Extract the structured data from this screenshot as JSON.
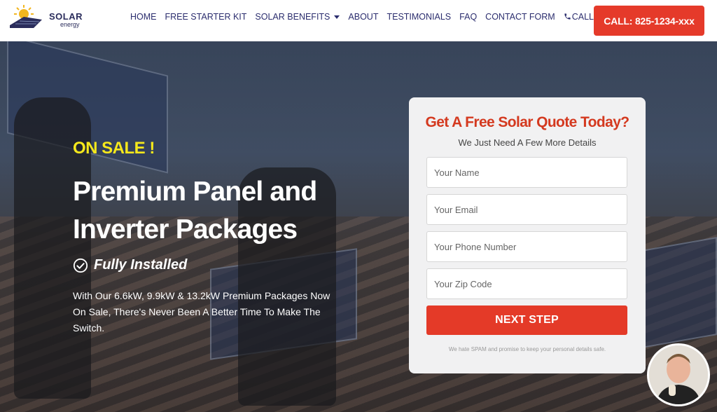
{
  "header": {
    "logo_text": "SOLAR",
    "logo_sub": "energy",
    "nav": [
      {
        "label": "HOME"
      },
      {
        "label": "FREE STARTER KIT"
      },
      {
        "label": "SOLAR BENEFITS"
      },
      {
        "label": "ABOUT"
      },
      {
        "label": "TESTIMONIALS"
      },
      {
        "label": "FAQ"
      },
      {
        "label": "CONTACT FORM"
      },
      {
        "label": "CALL US NOW!"
      }
    ],
    "call_button": "CALL: 825-1234-xxx"
  },
  "hero": {
    "badge": "ON SALE !",
    "title": "Premium Panel and Inverter Packages",
    "installed": "Fully Installed",
    "description": "With Our 6.6kW, 9.9kW & 13.2kW Premium Packages Now On Sale, There's Never Been A Better Time To Make The Switch."
  },
  "form": {
    "title": "Get A Free Solar Quote Today?",
    "subtitle": "We Just Need A Few More Details",
    "fields": {
      "name": "Your Name",
      "email": "Your Email",
      "phone": "Your Phone Number",
      "zip": "Your Zip Code"
    },
    "submit": "NEXT STEP",
    "note": "We hate SPAM and promise to keep your personal details safe."
  },
  "colors": {
    "accent_red": "#e53a2a",
    "nav_text": "#2b2d6e",
    "sale_yellow": "#f5e81c",
    "form_title": "#d4391f"
  }
}
